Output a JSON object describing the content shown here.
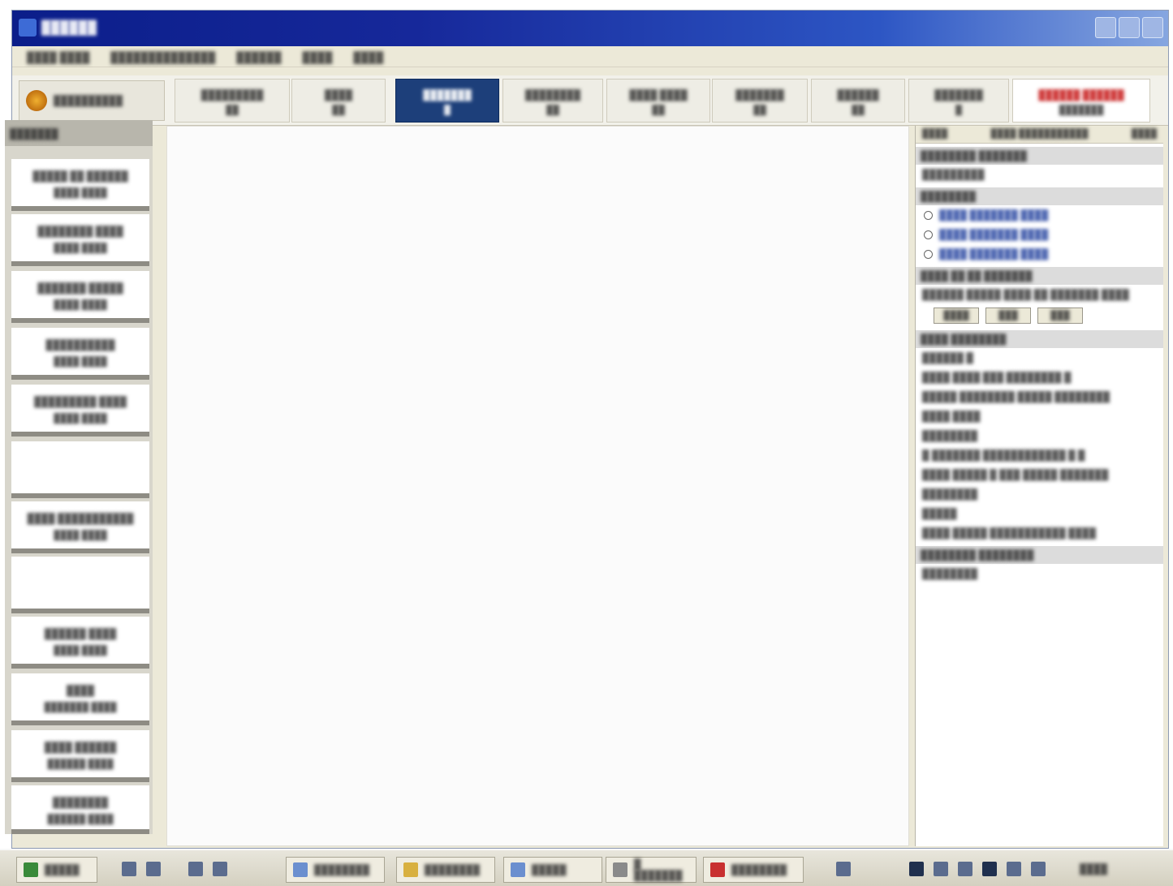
{
  "window": {
    "title": "██████",
    "menus": [
      "████ ████",
      "██████████████",
      "██████",
      "████",
      "████"
    ]
  },
  "toolbar": {
    "logo_text": "██████████",
    "tabs": [
      {
        "label": "█████████",
        "sub": "██"
      },
      {
        "label": "████",
        "sub": "██"
      },
      {
        "label": "███████",
        "sub": "█"
      },
      {
        "label": "████████",
        "sub": "██"
      },
      {
        "label": "████ ████",
        "sub": "██"
      },
      {
        "label": "███████",
        "sub": "██"
      },
      {
        "label": "██████",
        "sub": "██"
      },
      {
        "label": "███████",
        "sub": "█"
      },
      {
        "label": "██████ ██████",
        "sub": "███████"
      }
    ]
  },
  "sidebar": {
    "header": "███████",
    "items": [
      {
        "l1": "█████ ██ ██████",
        "l2": "████ ████"
      },
      {
        "l1": "████████ ████",
        "l2": "████ ████"
      },
      {
        "l1": "███████ █████",
        "l2": "████ ████"
      },
      {
        "l1": "██████████",
        "l2": "████ ████"
      },
      {
        "l1": "█████████ ████",
        "l2": "████ ████"
      },
      {
        "l1": "",
        "l2": ""
      },
      {
        "l1": "████ ███████████",
        "l2": "████ ████"
      },
      {
        "l1": "",
        "l2": ""
      },
      {
        "l1": "██████ ████",
        "l2": "████ ████"
      },
      {
        "l1": "████",
        "l2": "███████ ████"
      },
      {
        "l1": "████ ██████",
        "l2": "██████ ████"
      },
      {
        "l1": "████████",
        "l2": "██████ ████"
      }
    ]
  },
  "rpanel": {
    "top_left": "████",
    "top_mid": "████ ███████████",
    "top_right": "████",
    "sec1": "████████ ███████",
    "sec1_val": "█████████",
    "sec2": "████████",
    "radios": [
      "████ ███████ ████",
      "████ ███████ ████",
      "████ ███████ ████"
    ],
    "sec3": "████ ██ ██ ███████",
    "sec3_line": "██████ █████ ████ ██ ███████ ████",
    "btn_a": "████",
    "btn_b": "███",
    "btn_c": "███",
    "sec4": "████ ████████",
    "lines": [
      "██████ █",
      "████ ████ ███ ████████ █",
      "█████ ████████ █████ ████████",
      "████ ████",
      "████████",
      "█ ███████ ████████████ █ █",
      "████ █████ █ ███ █████ ███████",
      "████████",
      "█████",
      "████ █████ ███████████ ████"
    ],
    "sec5": "████████ ████████",
    "sec5_val": "████████"
  },
  "taskbar": {
    "start": "█████",
    "items": [
      "████████",
      "████████",
      "█████",
      "█ ███████",
      "████████"
    ],
    "clock": "████"
  }
}
